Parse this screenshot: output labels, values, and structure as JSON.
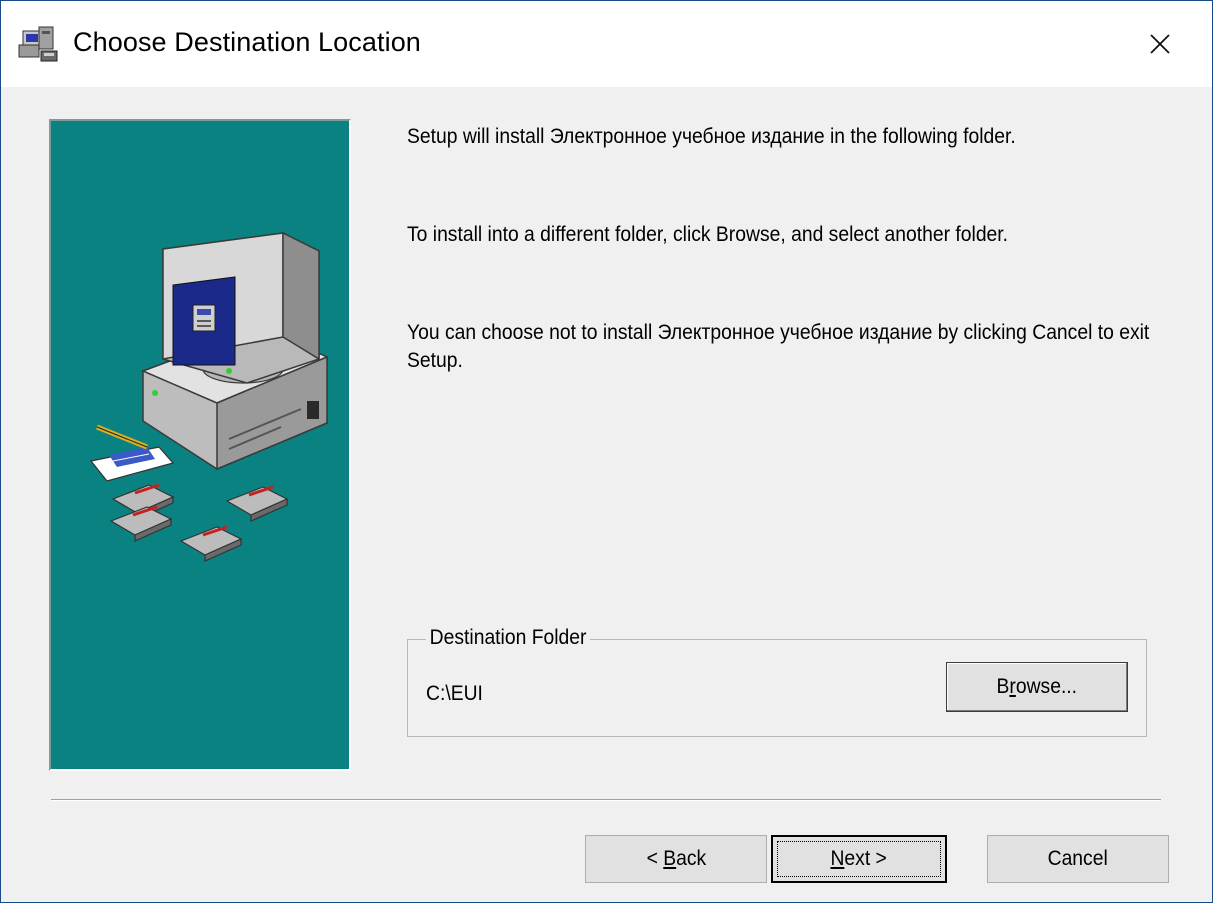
{
  "window": {
    "title": "Choose Destination Location",
    "close_glyph": "×"
  },
  "content": {
    "paragraph1": "Setup will install Электронное учебное издание in the following folder.",
    "paragraph2": "To install into a different folder, click Browse, and select another folder.",
    "paragraph3": "You can choose not to install Электронное учебное издание by clicking Cancel to exit Setup."
  },
  "destination": {
    "legend": "Destination Folder",
    "path": "C:\\EUI",
    "browse_label": "Browse...",
    "browse_mnemonic": "r"
  },
  "buttons": {
    "back_label": "< Back",
    "back_mnemonic": "B",
    "next_label": "Next >",
    "next_mnemonic": "N",
    "cancel_label": "Cancel"
  },
  "colors": {
    "side_panel": "#0b8282",
    "dialog_bg": "#f0f0f0",
    "button_bg": "#e1e1e1"
  },
  "icons": {
    "title": "installer-computer-icon",
    "close": "close-icon",
    "illustration": "computer-with-floppy-disks-illustration"
  }
}
